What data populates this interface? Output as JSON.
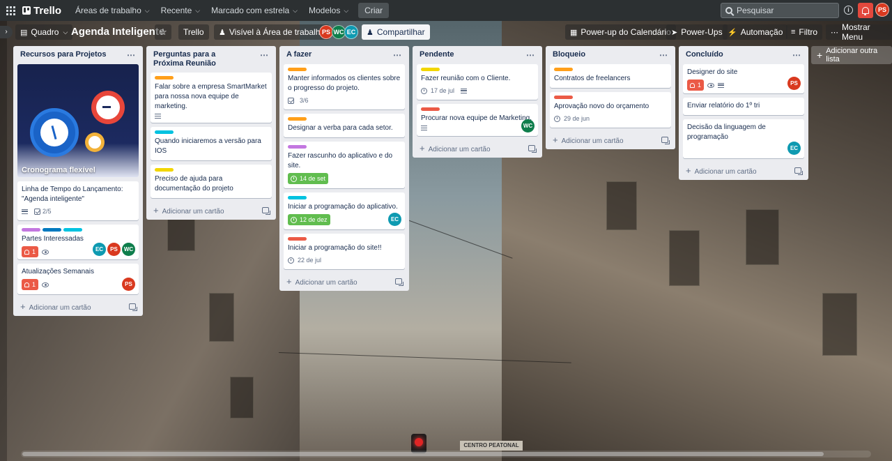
{
  "colors": {
    "label_orange": "#ff9f1a",
    "label_yellow": "#f2d600",
    "label_blue": "#00c2e0",
    "label_purple": "#c377e0",
    "label_sky": "#0079bf",
    "label_red": "#eb5a46",
    "date_green": "#61bd4f"
  },
  "topnav": {
    "logo": "Trello",
    "menus": [
      {
        "label": "Áreas de trabalho"
      },
      {
        "label": "Recente"
      },
      {
        "label": "Marcado com estrela"
      },
      {
        "label": "Modelos"
      }
    ],
    "create_label": "Criar",
    "search_placeholder": "Pesquisar",
    "user_initials": "PS"
  },
  "boardbar": {
    "view_label": "Quadro",
    "board_title": "Agenda Inteligente",
    "workspace_label": "Trello",
    "visibility_label": "Visível à Área de trabalho",
    "members": [
      "PS",
      "WC",
      "EC"
    ],
    "share_label": "Compartilhar",
    "calendar_label": "Power-up do Calendário",
    "powerups_label": "Power-Ups",
    "automation_label": "Automação",
    "filter_label": "Filtro",
    "menu_label": "Mostrar Menu"
  },
  "lists": [
    {
      "title": "Recursos para Projetos",
      "cover_title": "Cronograma flexível",
      "cards": [
        {
          "title": "Linha de Tempo do Lançamento: \"Agenda inteligente\"",
          "checklist": "2/5"
        },
        {
          "title": "Partes Interessadas",
          "notif": "1",
          "members": [
            "EC",
            "PS",
            "WC"
          ]
        },
        {
          "title": "Atualizações Semanais",
          "notif": "1",
          "members": [
            "PS"
          ]
        }
      ],
      "add_label": "Adicionar um cartão"
    },
    {
      "title": "Perguntas para a Próxima Reunião",
      "cards": [
        {
          "title": "Falar sobre a empresa SmartMarket para nossa nova equipe de marketing."
        },
        {
          "title": "Quando iniciaremos a versão para IOS"
        },
        {
          "title": "Preciso de ajuda para documentação do projeto"
        }
      ],
      "add_label": "Adicionar um cartão"
    },
    {
      "title": "A fazer",
      "cards": [
        {
          "title": "Manter informados os clientes sobre o progresso do projeto.",
          "checklist": "3/6"
        },
        {
          "title": "Designar a verba para cada setor."
        },
        {
          "title": "Fazer rascunho do aplicativo e do site.",
          "due": "14 de set"
        },
        {
          "title": "Iniciar a programação do aplicativo.",
          "due": "12 de dez",
          "members": [
            "EC"
          ]
        },
        {
          "title": "Iniciar a programação do site!!",
          "due": "22 de jul"
        }
      ],
      "add_label": "Adicionar um cartão"
    },
    {
      "title": "Pendente",
      "cards": [
        {
          "title": "Fazer reunião com o Cliente.",
          "due": "17 de jul"
        },
        {
          "title": "Procurar nova equipe de Marketing.",
          "members": [
            "WC"
          ]
        }
      ],
      "add_label": "Adicionar um cartão"
    },
    {
      "title": "Bloqueio",
      "cards": [
        {
          "title": "Contratos de freelancers"
        },
        {
          "title": "Aprovação novo do orçamento",
          "due": "29 de jun"
        }
      ],
      "add_label": "Adicionar um cartão"
    },
    {
      "title": "Concluído",
      "cards": [
        {
          "title": "Designer do site",
          "notif": "1",
          "members": [
            "PS"
          ]
        },
        {
          "title": "Enviar relatório do 1º tri"
        },
        {
          "title": "Decisão da linguagem de programação",
          "members": [
            "EC"
          ]
        }
      ],
      "add_label": "Adicionar um cartão"
    }
  ],
  "add_list_label": "Adicionar outra lista",
  "street_sign": "CENTRO PEATONAL"
}
